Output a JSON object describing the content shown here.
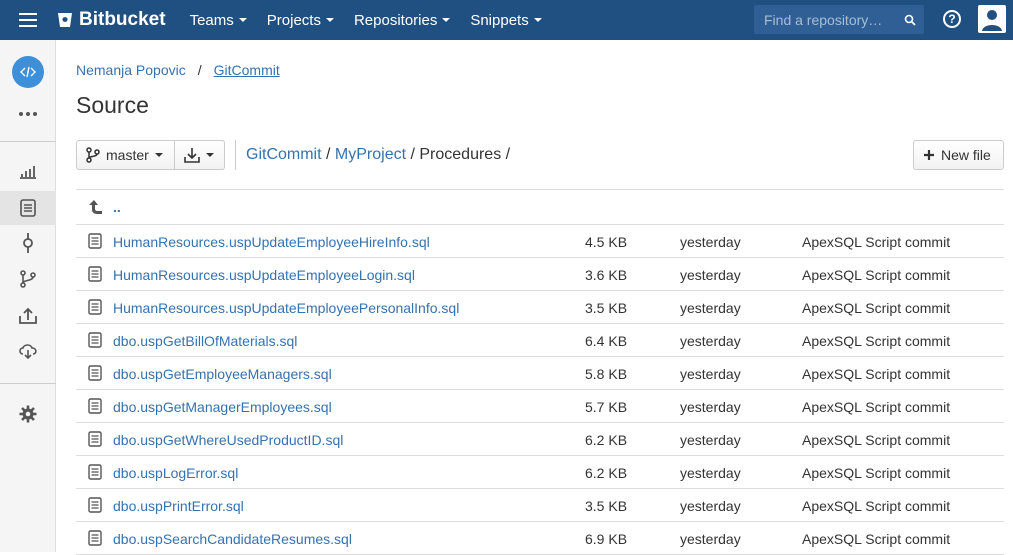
{
  "brand": {
    "name": "Bitbucket"
  },
  "nav": {
    "items": [
      {
        "label": "Teams"
      },
      {
        "label": "Projects"
      },
      {
        "label": "Repositories"
      },
      {
        "label": "Snippets"
      }
    ],
    "search_placeholder": "Find a repository…",
    "help_glyph": "?"
  },
  "breadcrumb": {
    "owner": "Nemanja Popovic",
    "separator": "/",
    "repo": "GitCommit"
  },
  "page_title": "Source",
  "toolbar": {
    "branch": "master",
    "new_file_label": "New file"
  },
  "path": {
    "parts": [
      "GitCommit",
      "MyProject"
    ],
    "current": "Procedures",
    "sep": " / "
  },
  "files": {
    "parent_label": "..",
    "rows": [
      {
        "name": "HumanResources.uspUpdateEmployeeHireInfo.sql",
        "size": "4.5 KB",
        "when": "yesterday",
        "message": "ApexSQL Script commit"
      },
      {
        "name": "HumanResources.uspUpdateEmployeeLogin.sql",
        "size": "3.6 KB",
        "when": "yesterday",
        "message": "ApexSQL Script commit"
      },
      {
        "name": "HumanResources.uspUpdateEmployeePersonalInfo.sql",
        "size": "3.5 KB",
        "when": "yesterday",
        "message": "ApexSQL Script commit"
      },
      {
        "name": "dbo.uspGetBillOfMaterials.sql",
        "size": "6.4 KB",
        "when": "yesterday",
        "message": "ApexSQL Script commit"
      },
      {
        "name": "dbo.uspGetEmployeeManagers.sql",
        "size": "5.8 KB",
        "when": "yesterday",
        "message": "ApexSQL Script commit"
      },
      {
        "name": "dbo.uspGetManagerEmployees.sql",
        "size": "5.7 KB",
        "when": "yesterday",
        "message": "ApexSQL Script commit"
      },
      {
        "name": "dbo.uspGetWhereUsedProductID.sql",
        "size": "6.2 KB",
        "when": "yesterday",
        "message": "ApexSQL Script commit"
      },
      {
        "name": "dbo.uspLogError.sql",
        "size": "6.2 KB",
        "when": "yesterday",
        "message": "ApexSQL Script commit"
      },
      {
        "name": "dbo.uspPrintError.sql",
        "size": "3.5 KB",
        "when": "yesterday",
        "message": "ApexSQL Script commit"
      },
      {
        "name": "dbo.uspSearchCandidateResumes.sql",
        "size": "6.9 KB",
        "when": "yesterday",
        "message": "ApexSQL Script commit"
      }
    ]
  },
  "colors": {
    "topbar": "#205081",
    "link": "#3572b0",
    "repo_avatar": "#3d8fd8"
  }
}
